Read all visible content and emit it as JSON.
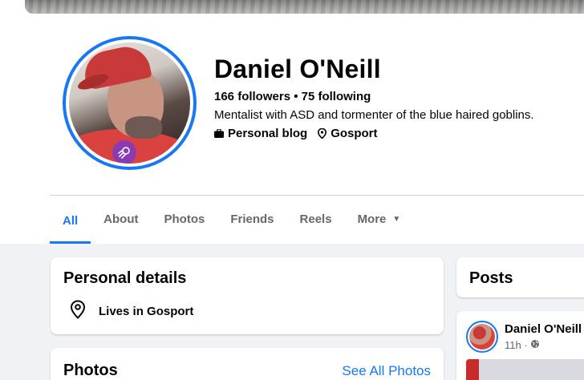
{
  "profile": {
    "name": "Daniel O'Neill",
    "stats": "166 followers • 75 following",
    "bio": "Mentalist with ASD and tormenter of the blue haired goblins.",
    "links": [
      {
        "icon": "briefcase-icon",
        "label": "Personal blog"
      },
      {
        "icon": "location-pin-icon",
        "label": "Gosport"
      }
    ]
  },
  "tabs": [
    {
      "label": "All",
      "active": true
    },
    {
      "label": "About"
    },
    {
      "label": "Photos"
    },
    {
      "label": "Friends"
    },
    {
      "label": "Reels"
    },
    {
      "label": "More",
      "icon": "caret-down-icon"
    }
  ],
  "personal_details": {
    "title": "Personal details",
    "lives_in": "Lives in Gosport"
  },
  "photos": {
    "title": "Photos",
    "see_all": "See All Photos"
  },
  "posts": {
    "title": "Posts",
    "first": {
      "author": "Daniel O'Neill",
      "time": "11h ·",
      "privacy_icon": "globe-icon"
    }
  },
  "colors": {
    "accent": "#1877f2",
    "text": "#050505",
    "secondary_text": "#65676b",
    "background": "#f0f2f5",
    "avatar_badge": "#8a3bb2"
  }
}
